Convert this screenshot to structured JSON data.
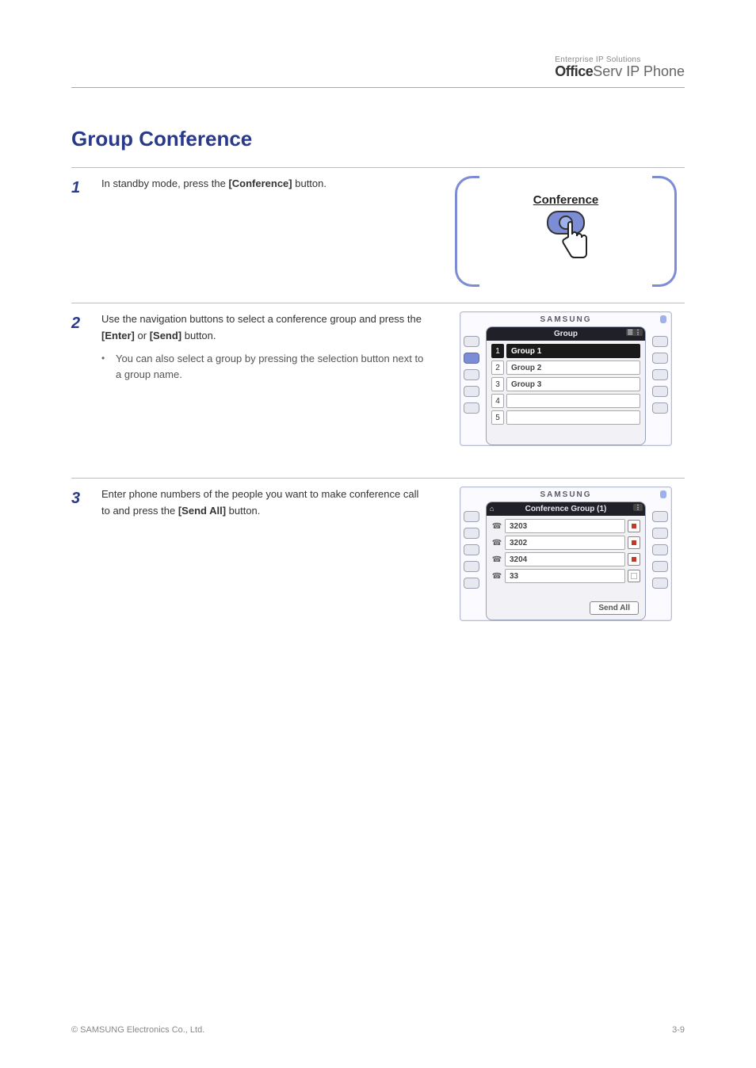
{
  "brand": {
    "small": "Enterprise IP Solutions",
    "bold": "Office",
    "serv": "Serv",
    "sub": " IP Phone"
  },
  "section_title": "Group Conference",
  "steps": [
    {
      "num": "1",
      "line1": "In standby mode, press the ",
      "bold1": "[Conference]",
      "line2": " button."
    },
    {
      "num": "2",
      "line1_a": "Use the navigation buttons to select a conference group and press the ",
      "bold1": "[Enter]",
      "line1_b": " or ",
      "bold2": "[Send]",
      "line1_c": " button.",
      "bullet": "You can also select a group by pressing the selection button next to a group name."
    },
    {
      "num": "3",
      "line1_a": "Enter phone numbers of the people you want to make conference call to and press the ",
      "bold1": "[Send All]",
      "line1_b": " button."
    }
  ],
  "illus_conf_label": "Conference",
  "phone1": {
    "samsung": "SAMSUNG",
    "title": "Group",
    "idx": [
      "1",
      "2",
      "3",
      "4",
      "5"
    ],
    "rows": [
      "Group 1",
      "Group 2",
      "Group 3",
      "",
      ""
    ]
  },
  "phone2": {
    "samsung": "SAMSUNG",
    "title": "Conference Group (1)",
    "rows": [
      "3203",
      "3202",
      "3204",
      "33"
    ],
    "sendall": "Send All"
  },
  "footer": {
    "copy_line1": "© SAMSUNG Electronics Co., Ltd.",
    "page": "3-9"
  }
}
